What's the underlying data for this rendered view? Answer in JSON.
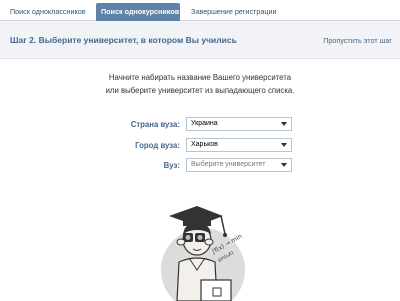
{
  "tabs": [
    {
      "label": "Поиск одноклассников"
    },
    {
      "label": "Поиск однокурсников"
    },
    {
      "label": "Завершение регистрации"
    }
  ],
  "header": {
    "title": "Шаг 2. Выберите университет, в котором Вы учились",
    "skip": "Пропустить этот шаг"
  },
  "intro": {
    "line1": "Начните набирать название Вашего университета",
    "line2": "или выберите университет из выпадающего списка."
  },
  "form": {
    "country_label": "Страна вуза:",
    "country_value": "Украина",
    "city_label": "Город вуза:",
    "city_value": "Харьков",
    "uni_label": "Вуз:",
    "uni_placeholder": "Выберите университет"
  },
  "mascot": {
    "formula": "∫f(x) → min",
    "formula_sub": "sin(ωt)"
  }
}
